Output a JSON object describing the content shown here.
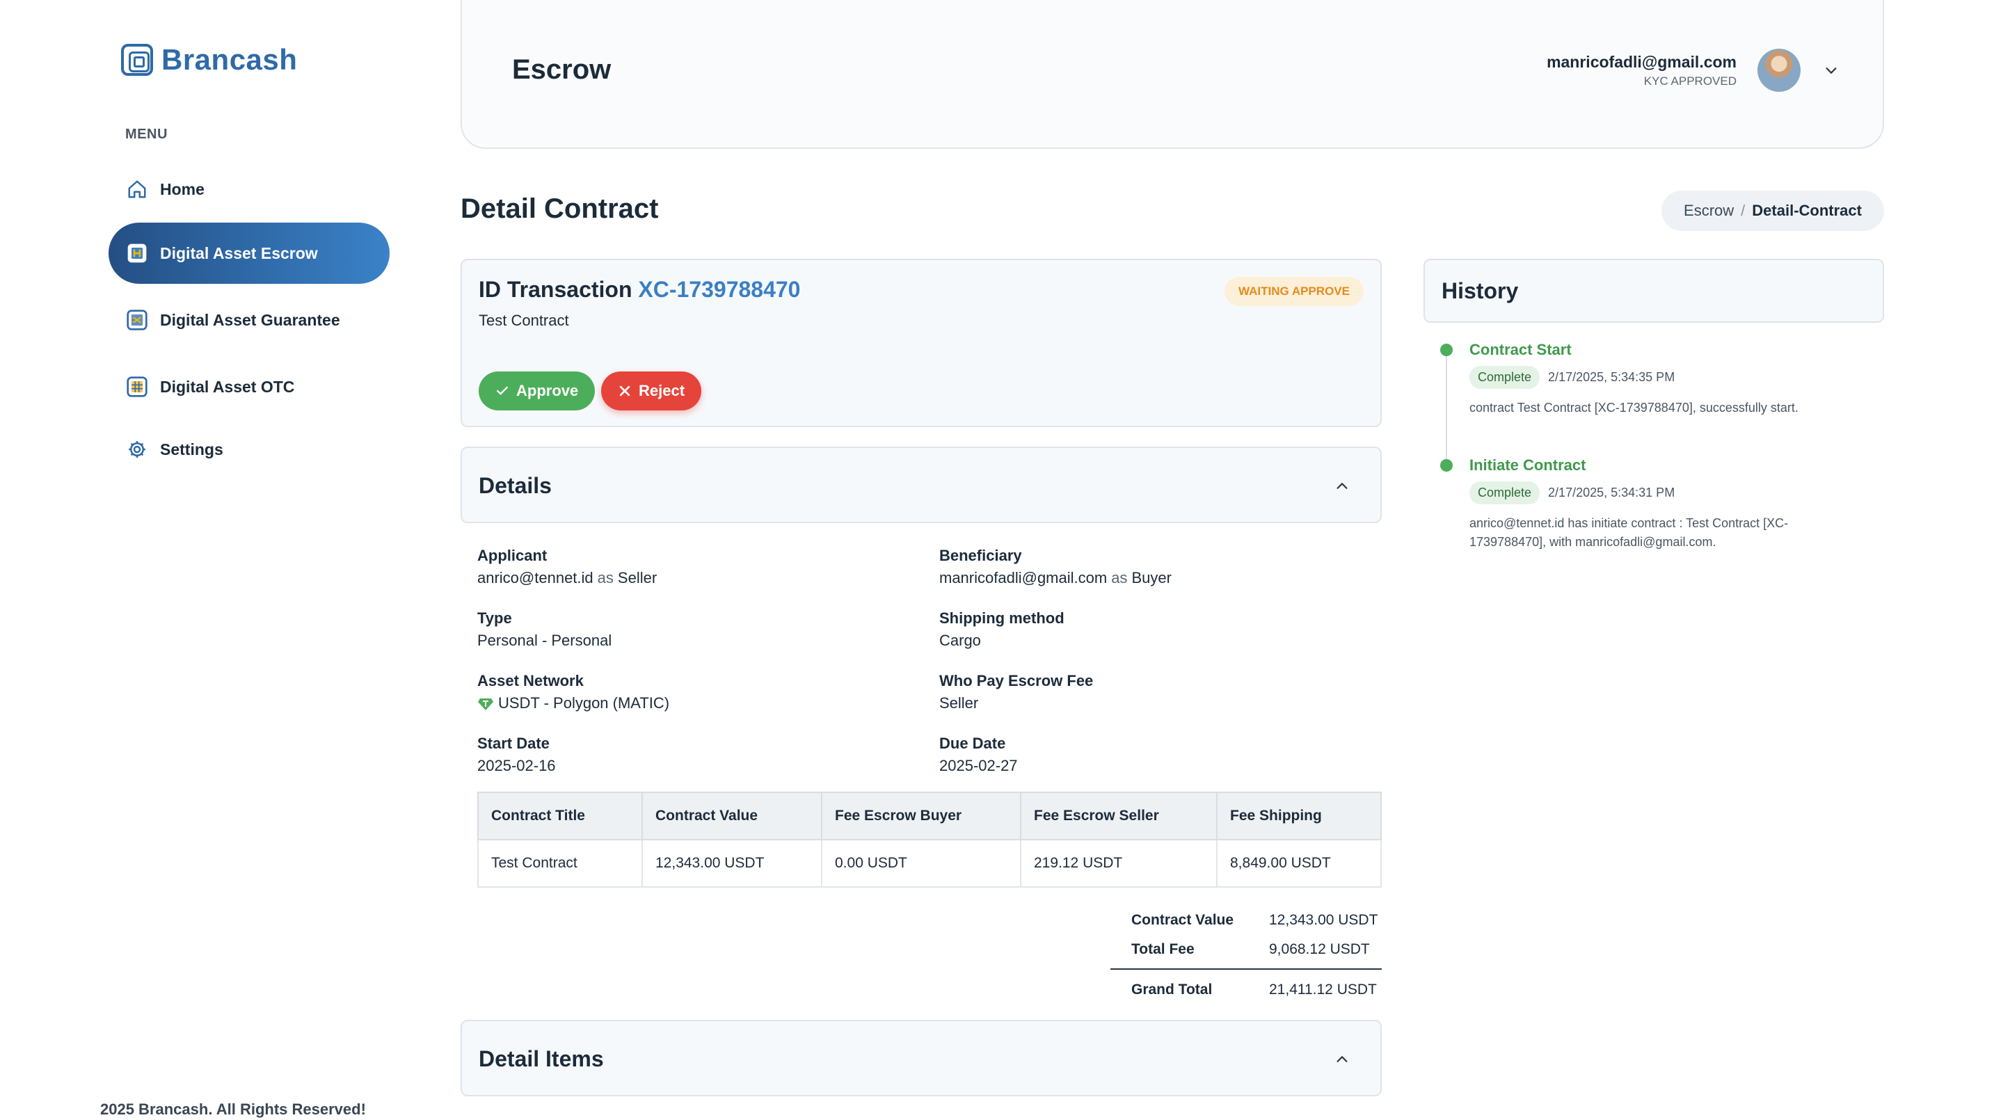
{
  "brand": {
    "name": "Brancash"
  },
  "sidebar": {
    "menu_label": "MENU",
    "items": [
      {
        "label": "Home",
        "icon": "home-icon"
      },
      {
        "label": "Digital Asset Escrow",
        "icon": "escrow-icon",
        "active": true
      },
      {
        "label": "Digital Asset Guarantee",
        "icon": "guarantee-icon"
      },
      {
        "label": "Digital Asset OTC",
        "icon": "otc-icon"
      },
      {
        "label": "Settings",
        "icon": "gear-icon"
      }
    ],
    "footer": "2025 Brancash. All Rights Reserved!"
  },
  "header": {
    "title": "Escrow",
    "user_email": "manricofadli@gmail.com",
    "kyc_status": "KYC APPROVED"
  },
  "page": {
    "title": "Detail Contract",
    "breadcrumb": {
      "parent": "Escrow",
      "separator": "/",
      "current": "Detail-Contract"
    }
  },
  "transaction": {
    "label": "ID Transaction",
    "id": "XC-1739788470",
    "name": "Test Contract",
    "status": "WAITING APPROVE",
    "approve_label": "Approve",
    "reject_label": "Reject"
  },
  "details": {
    "title": "Details",
    "applicant": {
      "label": "Applicant",
      "email": "anrico@tennet.id",
      "as": "as",
      "role": "Seller"
    },
    "beneficiary": {
      "label": "Beneficiary",
      "email": "manricofadli@gmail.com",
      "as": "as",
      "role": "Buyer"
    },
    "type": {
      "label": "Type",
      "value": "Personal - Personal"
    },
    "shipping": {
      "label": "Shipping method",
      "value": "Cargo"
    },
    "network": {
      "label": "Asset Network",
      "value": "USDT - Polygon (MATIC)"
    },
    "fee_payer": {
      "label": "Who Pay Escrow Fee",
      "value": "Seller"
    },
    "start_date": {
      "label": "Start Date",
      "value": "2025-02-16"
    },
    "due_date": {
      "label": "Due Date",
      "value": "2025-02-27"
    },
    "table": {
      "headers": [
        "Contract Title",
        "Contract Value",
        "Fee Escrow Buyer",
        "Fee Escrow Seller",
        "Fee Shipping"
      ],
      "rows": [
        [
          "Test Contract",
          "12,343.00 USDT",
          "0.00 USDT",
          "219.12 USDT",
          "8,849.00 USDT"
        ]
      ]
    },
    "totals": {
      "contract_value_label": "Contract Value",
      "contract_value": "12,343.00 USDT",
      "total_fee_label": "Total Fee",
      "total_fee": "9,068.12 USDT",
      "grand_total_label": "Grand Total",
      "grand_total": "21,411.12 USDT"
    }
  },
  "detail_items": {
    "title": "Detail Items"
  },
  "history": {
    "title": "History",
    "events": [
      {
        "title": "Contract Start",
        "status": "Complete",
        "time": "2/17/2025, 5:34:35 PM",
        "description": "contract Test Contract [XC-1739788470], successfully start."
      },
      {
        "title": "Initiate Contract",
        "status": "Complete",
        "time": "2/17/2025, 5:34:31 PM",
        "description": "anrico@tennet.id has initiate contract : Test Contract [XC-1739788470], with manricofadli@gmail.com."
      }
    ]
  },
  "colors": {
    "primary": "#2f6aa8",
    "active_nav_start": "#244f84",
    "active_nav_end": "#3a82c8",
    "approve": "#4cae5a",
    "reject": "#e5443a",
    "waiting_badge_bg": "#fdf0d8",
    "waiting_badge_text": "#e58a1c",
    "timeline_green": "#4cae5a"
  }
}
